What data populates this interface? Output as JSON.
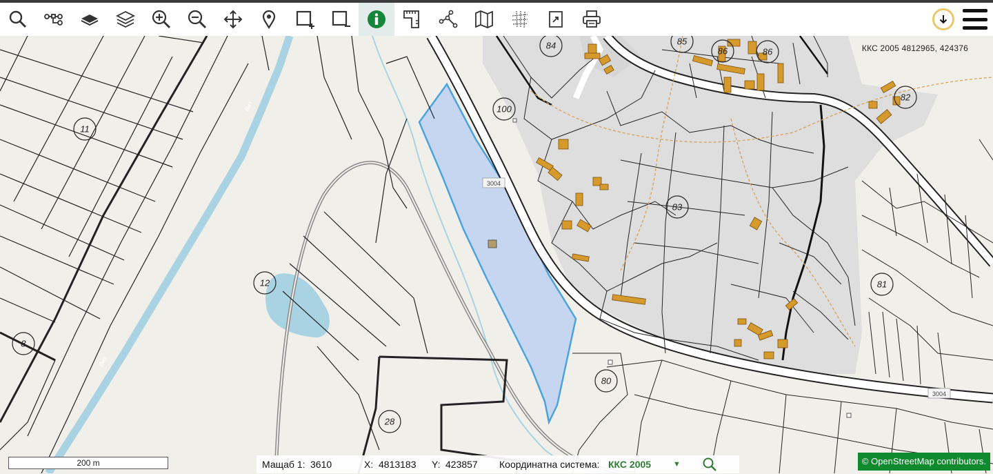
{
  "toolbar": {
    "tools": [
      {
        "name": "search",
        "icon": "search-icon"
      },
      {
        "name": "route",
        "icon": "route-icon"
      },
      {
        "name": "base-layer",
        "icon": "layer-icon"
      },
      {
        "name": "layers",
        "icon": "layers-stack-icon"
      },
      {
        "name": "zoom-in",
        "icon": "zoom-in-icon"
      },
      {
        "name": "zoom-out",
        "icon": "zoom-out-icon"
      },
      {
        "name": "pan",
        "icon": "move-icon"
      },
      {
        "name": "location",
        "icon": "map-pin-icon"
      },
      {
        "name": "select-add",
        "icon": "select-add-icon"
      },
      {
        "name": "select-remove",
        "icon": "select-remove-icon"
      },
      {
        "name": "info",
        "icon": "info-icon",
        "active": true
      },
      {
        "name": "measure-area",
        "icon": "ruler-area-icon"
      },
      {
        "name": "measure-polygon",
        "icon": "polygon-icon"
      },
      {
        "name": "map-view",
        "icon": "folded-map-icon"
      },
      {
        "name": "grid",
        "icon": "grid-icon"
      },
      {
        "name": "export",
        "icon": "export-icon"
      },
      {
        "name": "print",
        "icon": "print-icon"
      }
    ],
    "download_icon": "download-icon",
    "menu_icon": "hamburger-icon"
  },
  "map": {
    "coordinate_readout": "ККС 2005 4812965, 424376",
    "parcel_labels": [
      "84",
      "85",
      "86",
      "86",
      "82",
      "100",
      "11",
      "83",
      "12",
      "81",
      "8",
      "80",
      "28"
    ],
    "road_labels": [
      "3004",
      "3004"
    ],
    "water_labels": [
      "Вит",
      "Вит"
    ],
    "colors": {
      "background": "#f1efea",
      "urban_area": "#dedede",
      "selected_parcel": "#c7d6f0",
      "selected_outline": "#4aa3e0",
      "river": "#a9d3e3",
      "building": "#d59a2b",
      "road": "#ffffff",
      "osm_badge": "#0f8a2e",
      "crs_value": "#2e7d32"
    }
  },
  "status": {
    "scale_bar": "200 m",
    "scale_label": "Мащаб 1:",
    "scale_value": "3610",
    "x_label": "X:",
    "x_value": "4813183",
    "y_label": "Y:",
    "y_value": "423857",
    "crs_label": "Координатна система:",
    "crs_value": "ККС 2005",
    "crs_dropdown_icon": "dropdown-triangle-icon",
    "zoom_icon": "magnifier-icon",
    "osm_attribution": "©  OpenStreetMap  contributors."
  }
}
